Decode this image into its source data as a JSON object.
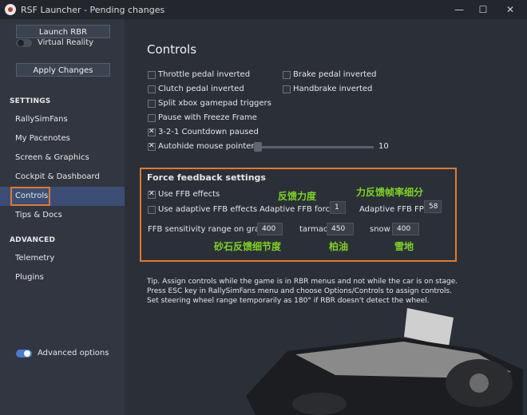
{
  "window": {
    "title": "RSF Launcher - Pending changes",
    "min_glyph": "—",
    "max_glyph": "☐",
    "close_glyph": "✕"
  },
  "sidebar": {
    "launch_label": "Launch RBR",
    "vr_label": "Virtual Reality",
    "vr_on": false,
    "apply_label": "Apply Changes",
    "settings_header": "SETTINGS",
    "settings_items": [
      "RallySimFans",
      "My Pacenotes",
      "Screen & Graphics",
      "Cockpit & Dashboard",
      "Controls",
      "Tips & Docs"
    ],
    "active_item": "Controls",
    "advanced_header": "ADVANCED",
    "advanced_items": [
      "Telemetry",
      "Plugins"
    ],
    "advanced_options_label": "Advanced options",
    "advanced_options_on": true
  },
  "main": {
    "heading": "Controls",
    "options": [
      {
        "label": "Throttle pedal inverted",
        "checked": false
      },
      {
        "label": "Brake pedal inverted",
        "checked": false
      },
      {
        "label": "Clutch pedal inverted",
        "checked": false
      },
      {
        "label": "Handbrake inverted",
        "checked": false
      },
      {
        "label": "Split xbox gamepad triggers",
        "checked": false
      },
      {
        "label": "Pause with Freeze Frame",
        "checked": false
      },
      {
        "label": "3-2-1 Countdown paused",
        "checked": true
      },
      {
        "label": "Autohide mouse pointer",
        "checked": true
      }
    ],
    "autohide_value": "10",
    "ffb": {
      "title": "Force feedback settings",
      "use_ffb_label": "Use FFB effects",
      "use_ffb_checked": true,
      "adaptive_label": "Use adaptive FFB effects",
      "adaptive_checked": false,
      "force_label": "Adaptive FFB force",
      "force_value": "1",
      "fps_label": "Adaptive FFB FPS",
      "fps_value": "58",
      "gravel_label": "FFB sensitivity range on gravel",
      "gravel_value": "400",
      "tarmac_label": "tarmac",
      "tarmac_value": "450",
      "snow_label": "snow",
      "snow_value": "400",
      "cn_force": "反馈力度",
      "cn_fps": "力反馈帧率细分",
      "cn_gravel": "砂石反馈细节度",
      "cn_tarmac": "柏油",
      "cn_snow": "雪地"
    },
    "tip_lines": [
      "Tip. Assign controls while the game is in RBR menus and not while the car is on stage.",
      "Press ESC key in RallySimFans menu and choose Options/Controls to assign controls.",
      "Set steering wheel range temporarily as 180° if RBR doesn't detect the wheel."
    ]
  },
  "colors": {
    "highlight": "#e07a2f",
    "chinese_annotation": "#7ed321",
    "toggle_on": "#4a78d8",
    "active_nav": "#3c4e75"
  }
}
